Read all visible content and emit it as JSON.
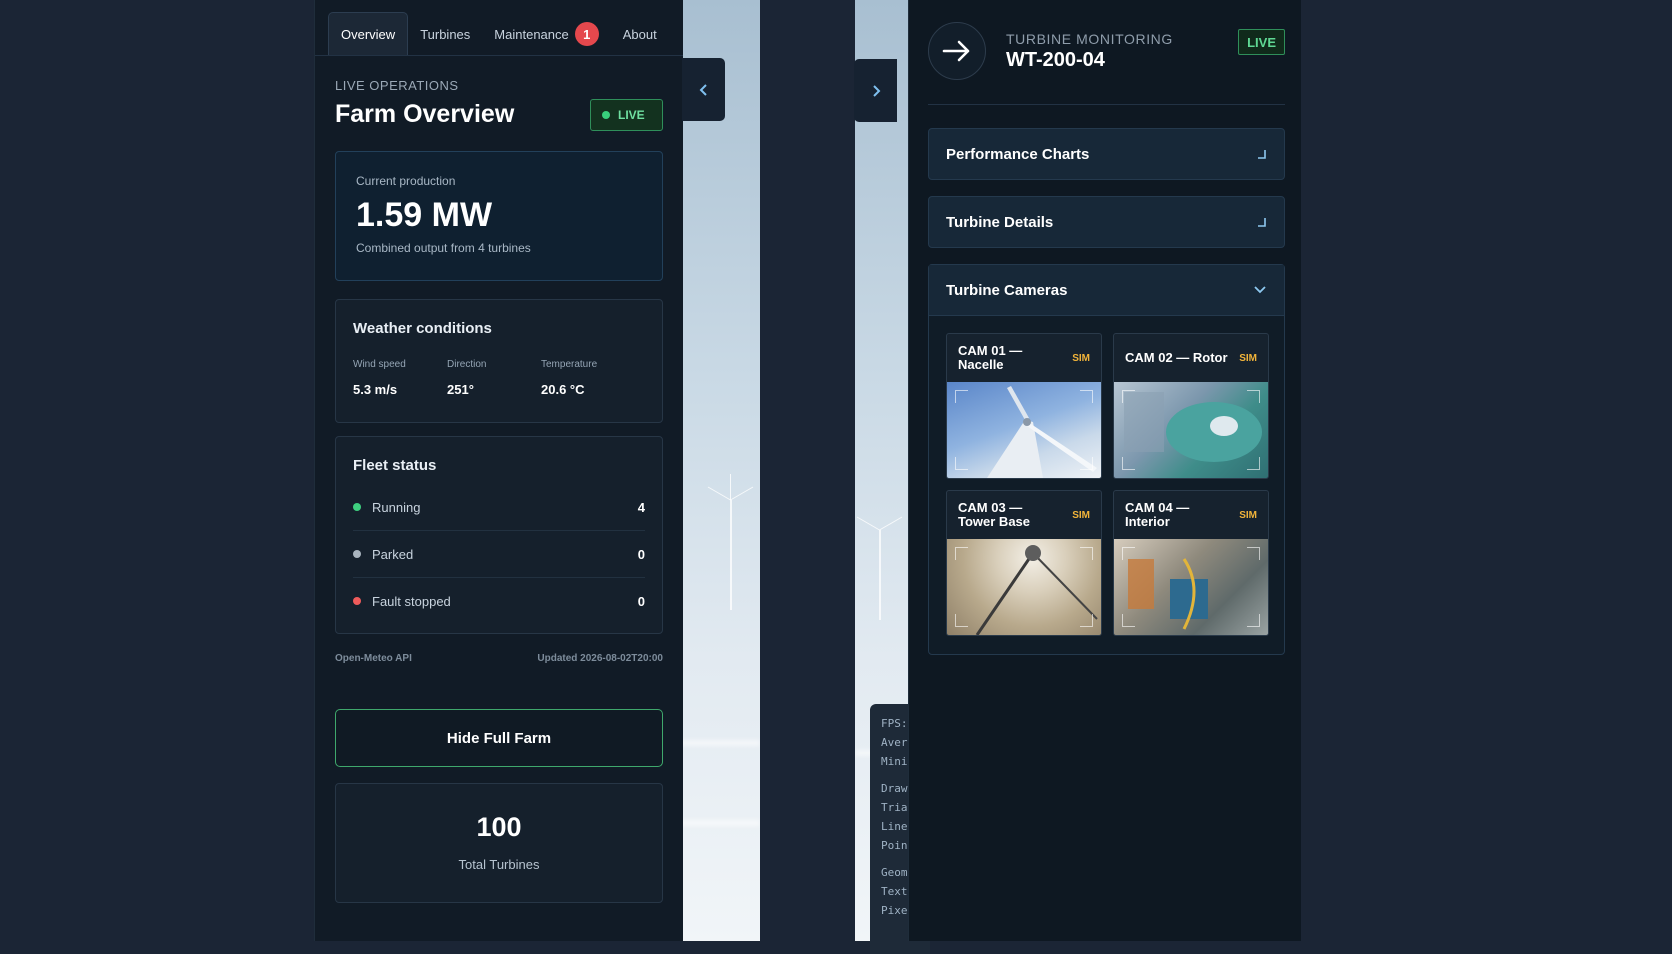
{
  "left": {
    "tabs": [
      {
        "label": "Overview",
        "active": true
      },
      {
        "label": "Turbines",
        "active": false
      },
      {
        "label": "Maintenance",
        "active": false,
        "badge": "1"
      },
      {
        "label": "About",
        "active": false
      }
    ],
    "kicker": "LIVE OPERATIONS",
    "title": "Farm Overview",
    "live_label": "LIVE",
    "production": {
      "label": "Current production",
      "value": "1.59 MW",
      "sub": "Combined output from 4 turbines"
    },
    "weather": {
      "title": "Weather conditions",
      "items": [
        {
          "label": "Wind speed",
          "value": "5.3 m/s"
        },
        {
          "label": "Direction",
          "value": "251°"
        },
        {
          "label": "Temperature",
          "value": "20.6 °C"
        }
      ]
    },
    "fleet": {
      "title": "Fleet status",
      "rows": [
        {
          "label": "Running",
          "count": "4",
          "color": "#3ecf7f"
        },
        {
          "label": "Parked",
          "count": "0",
          "color": "#a9b4bf"
        },
        {
          "label": "Fault stopped",
          "count": "0",
          "color": "#ef5b5b"
        }
      ]
    },
    "source": "Open-Meteo API",
    "updated": "Updated 2026-08-02T20:00",
    "hide_button": "Hide Full Farm",
    "total": {
      "value": "100",
      "label": "Total Turbines"
    }
  },
  "stats_overlay": [
    "FPS:",
    "Aver",
    "Mini",
    "",
    "Draw",
    "Tria",
    "Line",
    "Poin",
    "",
    "Geom",
    "Text",
    "Pixe"
  ],
  "right": {
    "kicker": "TURBINE MONITORING",
    "turbine_id": "WT-200-04",
    "live_label": "LIVE",
    "sections": [
      {
        "label": "Performance Charts",
        "open": false
      },
      {
        "label": "Turbine Details",
        "open": false
      },
      {
        "label": "Turbine Cameras",
        "open": true
      }
    ],
    "cameras": [
      {
        "name_line1": "CAM 01 —",
        "name_line2": "Nacelle",
        "tag": "SIM"
      },
      {
        "name_line1": "CAM 02 — Rotor",
        "name_line2": "",
        "tag": "SIM"
      },
      {
        "name_line1": "CAM 03 —",
        "name_line2": "Tower Base",
        "tag": "SIM"
      },
      {
        "name_line1": "CAM 04 —",
        "name_line2": "Interior",
        "tag": "SIM"
      }
    ]
  },
  "colors": {
    "accent_green": "#3ecf7f",
    "badge_red": "#e5484d",
    "sim_amber": "#f1b43a"
  }
}
